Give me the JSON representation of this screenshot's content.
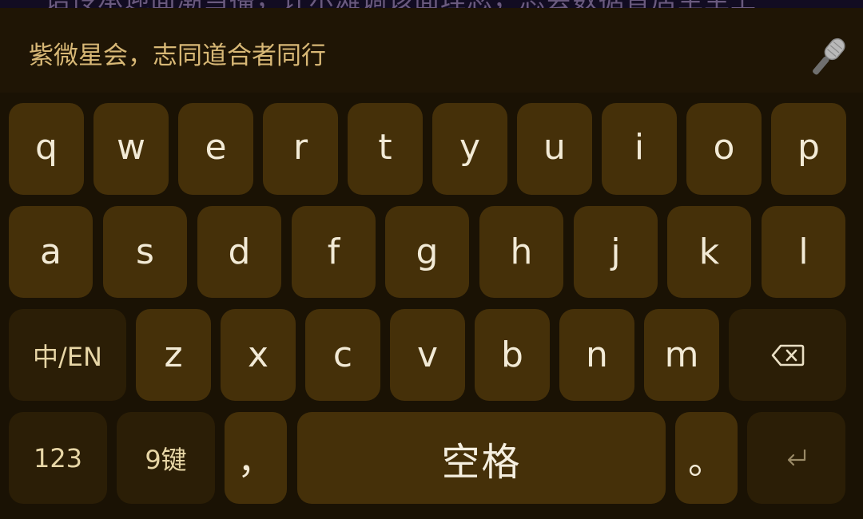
{
  "top_strip": {
    "text": "语传承迎面潮当播，计尔滩调该面理念，总会数据替居至至上"
  },
  "candidate_bar": {
    "suggestion": "紫微星会，志同道合者同行",
    "mic_icon": "microphone-icon"
  },
  "keyboard": {
    "colors": {
      "key": "#453009",
      "function_key": "#2b1e06",
      "background": "#1a1204",
      "label": "#f2ead6"
    },
    "row1": [
      "q",
      "w",
      "e",
      "r",
      "t",
      "y",
      "u",
      "i",
      "o",
      "p"
    ],
    "row2": [
      "a",
      "s",
      "d",
      "f",
      "g",
      "h",
      "j",
      "k",
      "l"
    ],
    "row3": {
      "lang_switch": "中/EN",
      "letters": [
        "z",
        "x",
        "c",
        "v",
        "b",
        "n",
        "m"
      ],
      "backspace_icon": "backspace-icon"
    },
    "row4": {
      "numbers": "123",
      "nine_key": "9键",
      "comma": "，",
      "space": "空格",
      "period": "。",
      "enter_icon": "enter-icon"
    }
  }
}
